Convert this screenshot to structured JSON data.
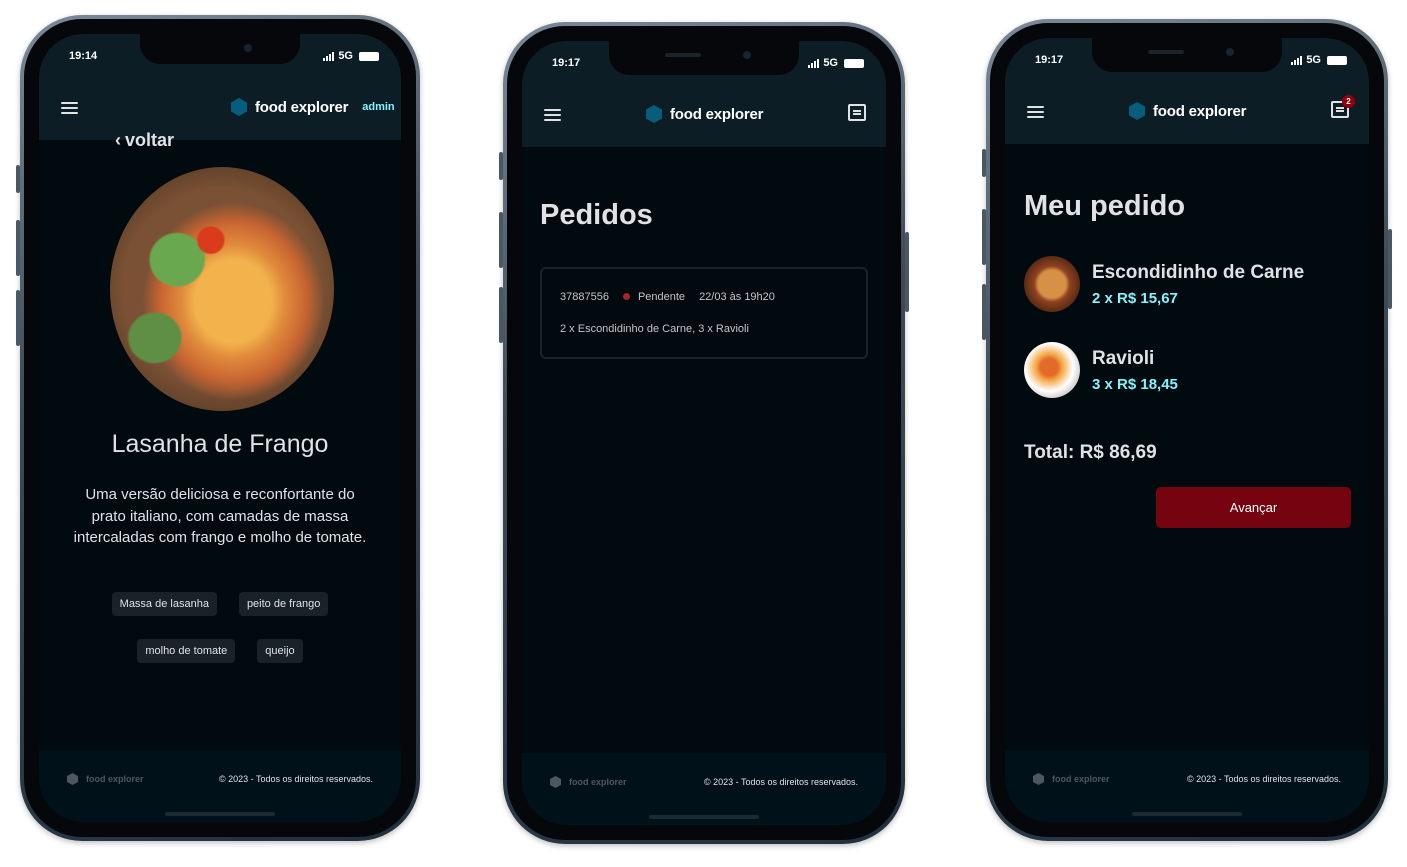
{
  "brand": {
    "name": "food explorer",
    "admin_label": "admin"
  },
  "footer": {
    "brand": "food explorer",
    "copyright": "© 2023 - Todos os direitos reservados."
  },
  "screens": [
    {
      "status_time": "19:14",
      "network": "5G",
      "back_label": "voltar",
      "dish": {
        "title": "Lasanha de Frango",
        "description": "Uma versão deliciosa e reconfortante do prato italiano, com camadas de massa intercaladas com frango e molho de tomate.",
        "ingredients": [
          "Massa de lasanha",
          "peito de frango",
          "molho de tomate",
          "queijo"
        ]
      }
    },
    {
      "status_time": "19:17",
      "network": "5G",
      "page_title": "Pedidos",
      "orders": [
        {
          "code": "37887556",
          "status": "Pendente",
          "status_color": "#ab222e",
          "date": "22/03 às 19h20",
          "items": "2 x Escondidinho de Carne, 3 x Ravioli"
        }
      ]
    },
    {
      "status_time": "19:17",
      "network": "5G",
      "cart_count": "2",
      "page_title": "Meu pedido",
      "items": [
        {
          "name": "Escondidinho de Carne",
          "qty_price": "2 x R$ 15,67"
        },
        {
          "name": "Ravioli",
          "qty_price": "3 x R$ 18,45"
        }
      ],
      "total": "Total: R$ 86,69",
      "advance_button": "Avançar"
    }
  ],
  "colors": {
    "accent_cyan": "#82f3ff",
    "brand_hex": "#065e7c",
    "button_red": "#750310",
    "header_bg": "#0d1d25"
  }
}
